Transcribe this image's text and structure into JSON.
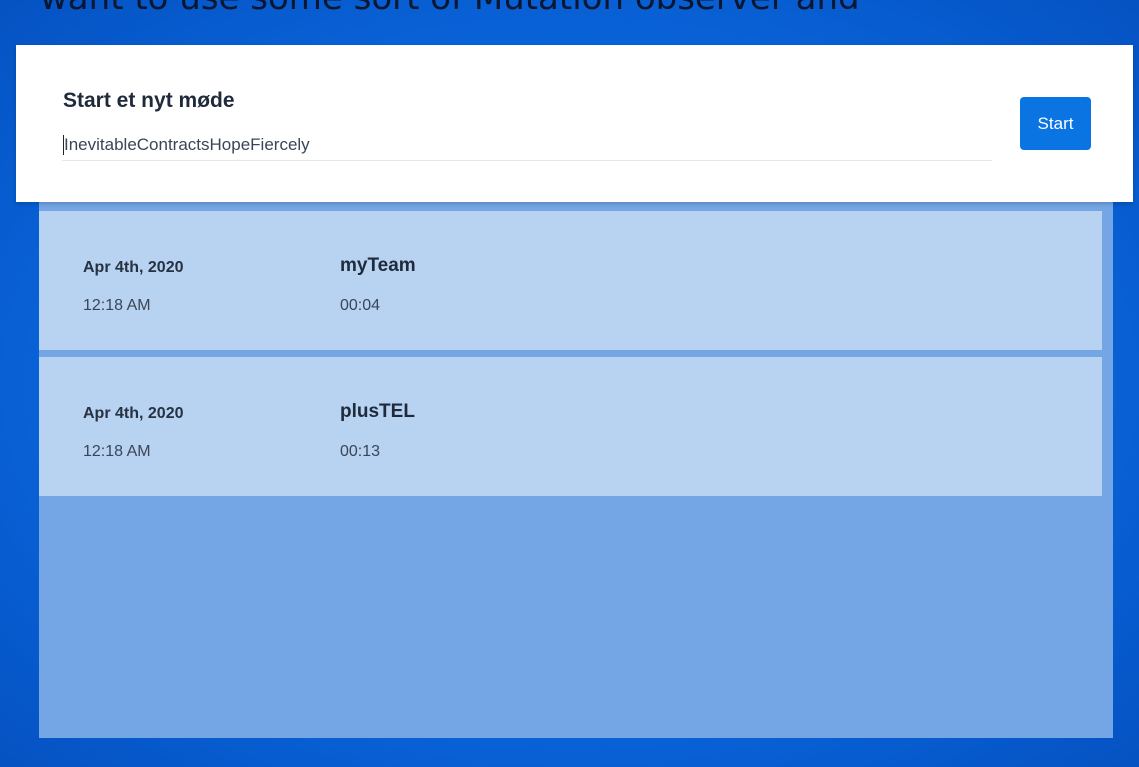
{
  "top_text": "want to use some sort of Mutation observer and",
  "new_meeting": {
    "title": "Start et nyt møde",
    "input_value": "InevitableContractsHopeFiercely",
    "start_label": "Start"
  },
  "meetings": [
    {
      "date": "Apr 4th, 2020",
      "time": "12:18 AM",
      "name": "myTeam",
      "duration": "00:04"
    },
    {
      "date": "Apr 4th, 2020",
      "time": "12:18 AM",
      "name": "plusTEL",
      "duration": "00:13"
    }
  ],
  "colors": {
    "background": "#0a6be2",
    "panel": "#74a6e6",
    "row": "#b8d2f2",
    "card": "#ffffff",
    "accent": "#0a74e2"
  }
}
